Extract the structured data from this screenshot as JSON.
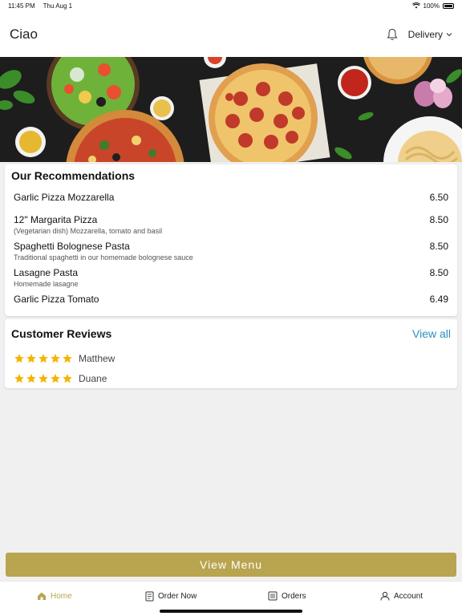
{
  "status_bar": {
    "time": "11:45 PM",
    "date": "Thu Aug 1",
    "battery": "100%"
  },
  "header": {
    "title": "Ciao",
    "delivery_label": "Delivery"
  },
  "recommendations": {
    "title": "Our Recommendations",
    "items": [
      {
        "name": "Garlic Pizza Mozzarella",
        "description": "",
        "price": "6.50"
      },
      {
        "name": "12\" Margarita Pizza",
        "description": "(Vegetarian dish) Mozzarella, tomato and basil",
        "price": "8.50"
      },
      {
        "name": "Spaghetti Bolognese Pasta",
        "description": "Traditional spaghetti in our homemade bolognese sauce",
        "price": "8.50"
      },
      {
        "name": "Lasagne Pasta",
        "description": "Homemade lasagne",
        "price": "8.50"
      },
      {
        "name": "Garlic Pizza Tomato",
        "description": "",
        "price": "6.49"
      }
    ]
  },
  "reviews": {
    "title": "Customer Reviews",
    "view_all_label": "View all",
    "items": [
      {
        "name": "Matthew",
        "rating": 5
      },
      {
        "name": "Duane",
        "rating": 5
      }
    ]
  },
  "view_menu_label": "View Menu",
  "nav": [
    {
      "label": "Home",
      "icon": "home-icon",
      "active": true
    },
    {
      "label": "Order Now",
      "icon": "order-icon",
      "active": false
    },
    {
      "label": "Orders",
      "icon": "orders-icon",
      "active": false
    },
    {
      "label": "Account",
      "icon": "account-icon",
      "active": false
    }
  ],
  "colors": {
    "accent": "#b9a44f",
    "link": "#2a8fc1",
    "star": "#f4b400"
  }
}
